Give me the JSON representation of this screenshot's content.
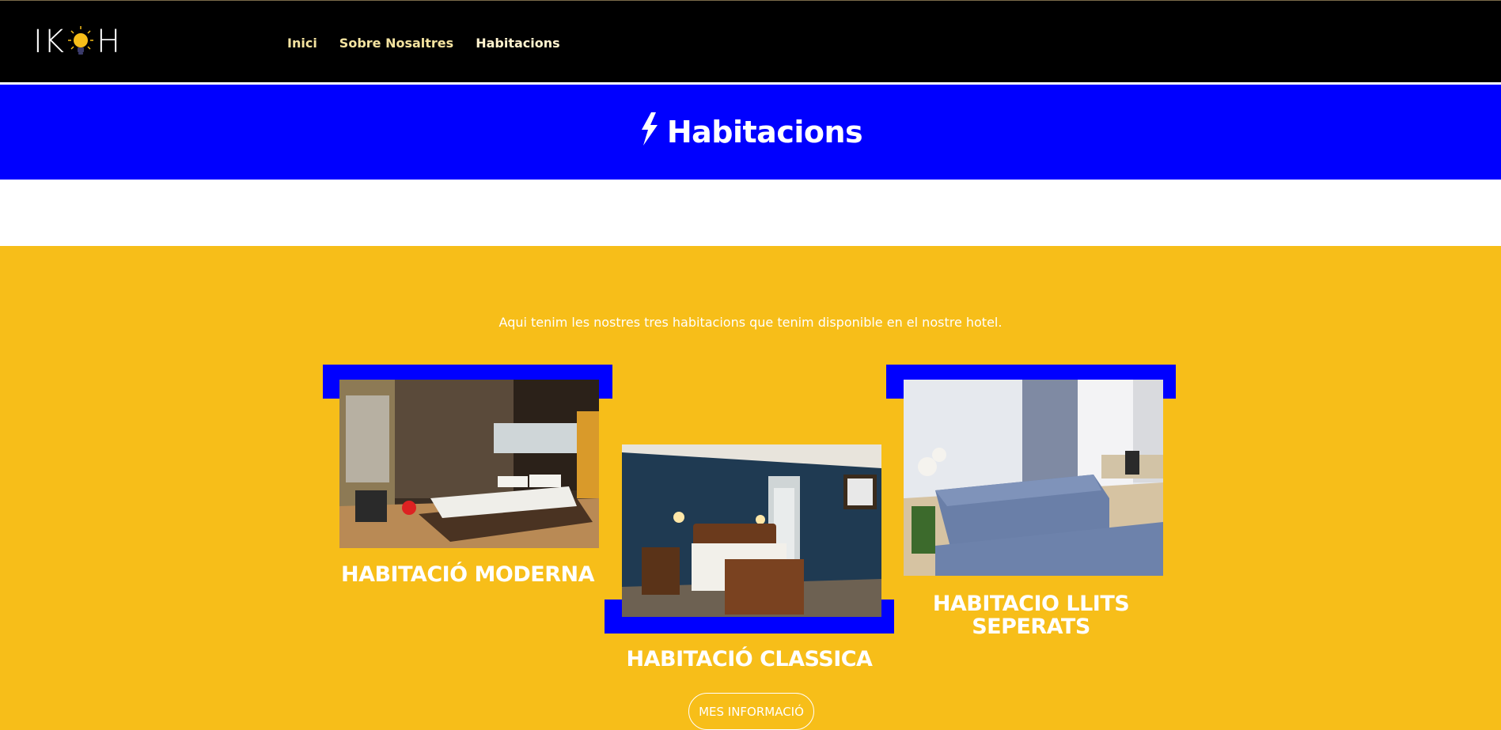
{
  "header": {
    "logo_text_left": "IK",
    "logo_text_right": "H",
    "nav": [
      {
        "label": "Inici"
      },
      {
        "label": "Sobre Nosaltres"
      },
      {
        "label": "Habitacions"
      }
    ]
  },
  "hero": {
    "title": "Habitacions"
  },
  "main": {
    "intro": "Aqui tenim les nostres tres habitacions que tenim disponible en el nostre hotel.",
    "rooms": [
      {
        "title": "HABITACIÓ MODERNA"
      },
      {
        "title": "HABITACIÓ CLASSICA"
      },
      {
        "title": "HABITACIO LLITS SEPERATS"
      }
    ],
    "button_label": "MES INFORMACIÓ"
  },
  "colors": {
    "header_bg": "#000000",
    "hero_bg": "#0000ff",
    "section_bg": "#f7be19",
    "accent_blue": "#0000ff"
  }
}
